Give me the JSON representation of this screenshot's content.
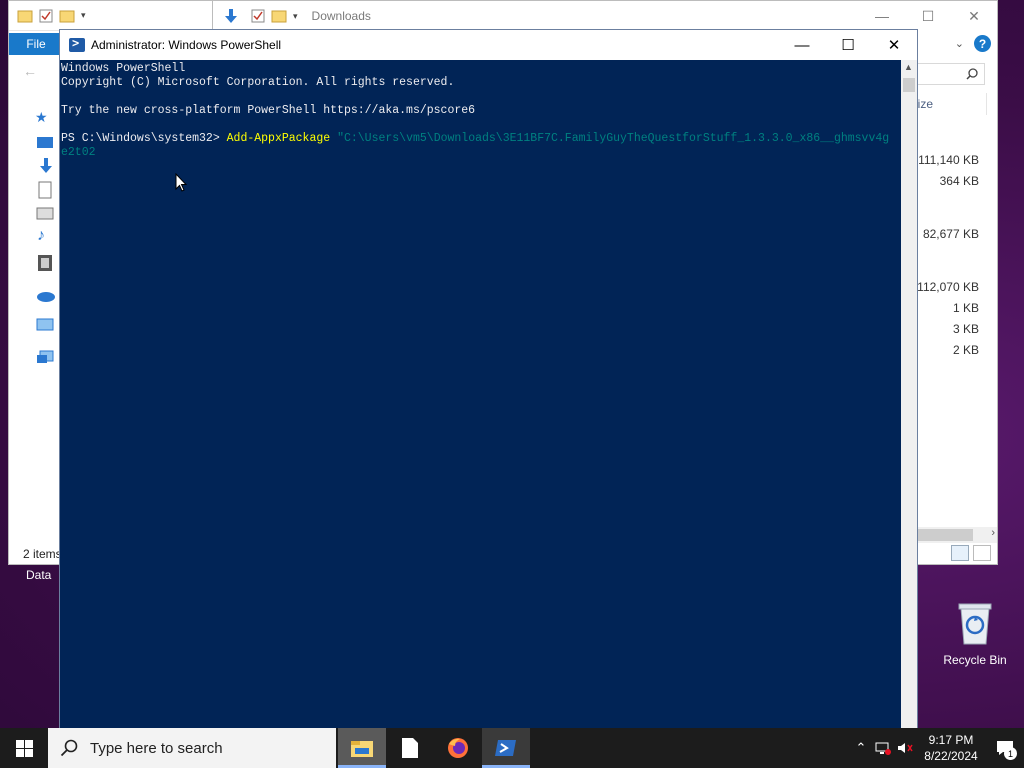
{
  "desktop": {
    "recycle_bin_label": "Recycle Bin",
    "data_label": "Data"
  },
  "explorer_back": {
    "file_tab": "File",
    "status": "2 items"
  },
  "explorer_main": {
    "title": "Downloads",
    "size_header": "Size",
    "sizes": [
      "111,140 KB",
      "364 KB",
      "82,677 KB",
      "112,070 KB",
      "1 KB",
      "3 KB",
      "2 KB"
    ]
  },
  "powershell": {
    "title": "Administrator: Windows PowerShell",
    "lines": {
      "l1": "Windows PowerShell",
      "l2": "Copyright (C) Microsoft Corporation. All rights reserved.",
      "l3": "Try the new cross-platform PowerShell https://aka.ms/pscore6",
      "prompt": "PS C:\\Windows\\system32> ",
      "cmd": "Add-AppxPackage",
      "arg1": " \"C:\\Users\\vm5\\Downloads\\3E11BF7C.FamilyGuyTheQuestforStuff_1.3.3.0_x86__ghmsvv4g",
      "arg2": "e2t02"
    }
  },
  "taskbar": {
    "search_placeholder": "Type here to search",
    "time": "9:17 PM",
    "date": "8/22/2024",
    "notification_count": "1"
  },
  "colors": {
    "ps_background": "#012456",
    "ps_command": "#ffff00",
    "ps_argument": "#008080",
    "accent": "#1979ca"
  }
}
